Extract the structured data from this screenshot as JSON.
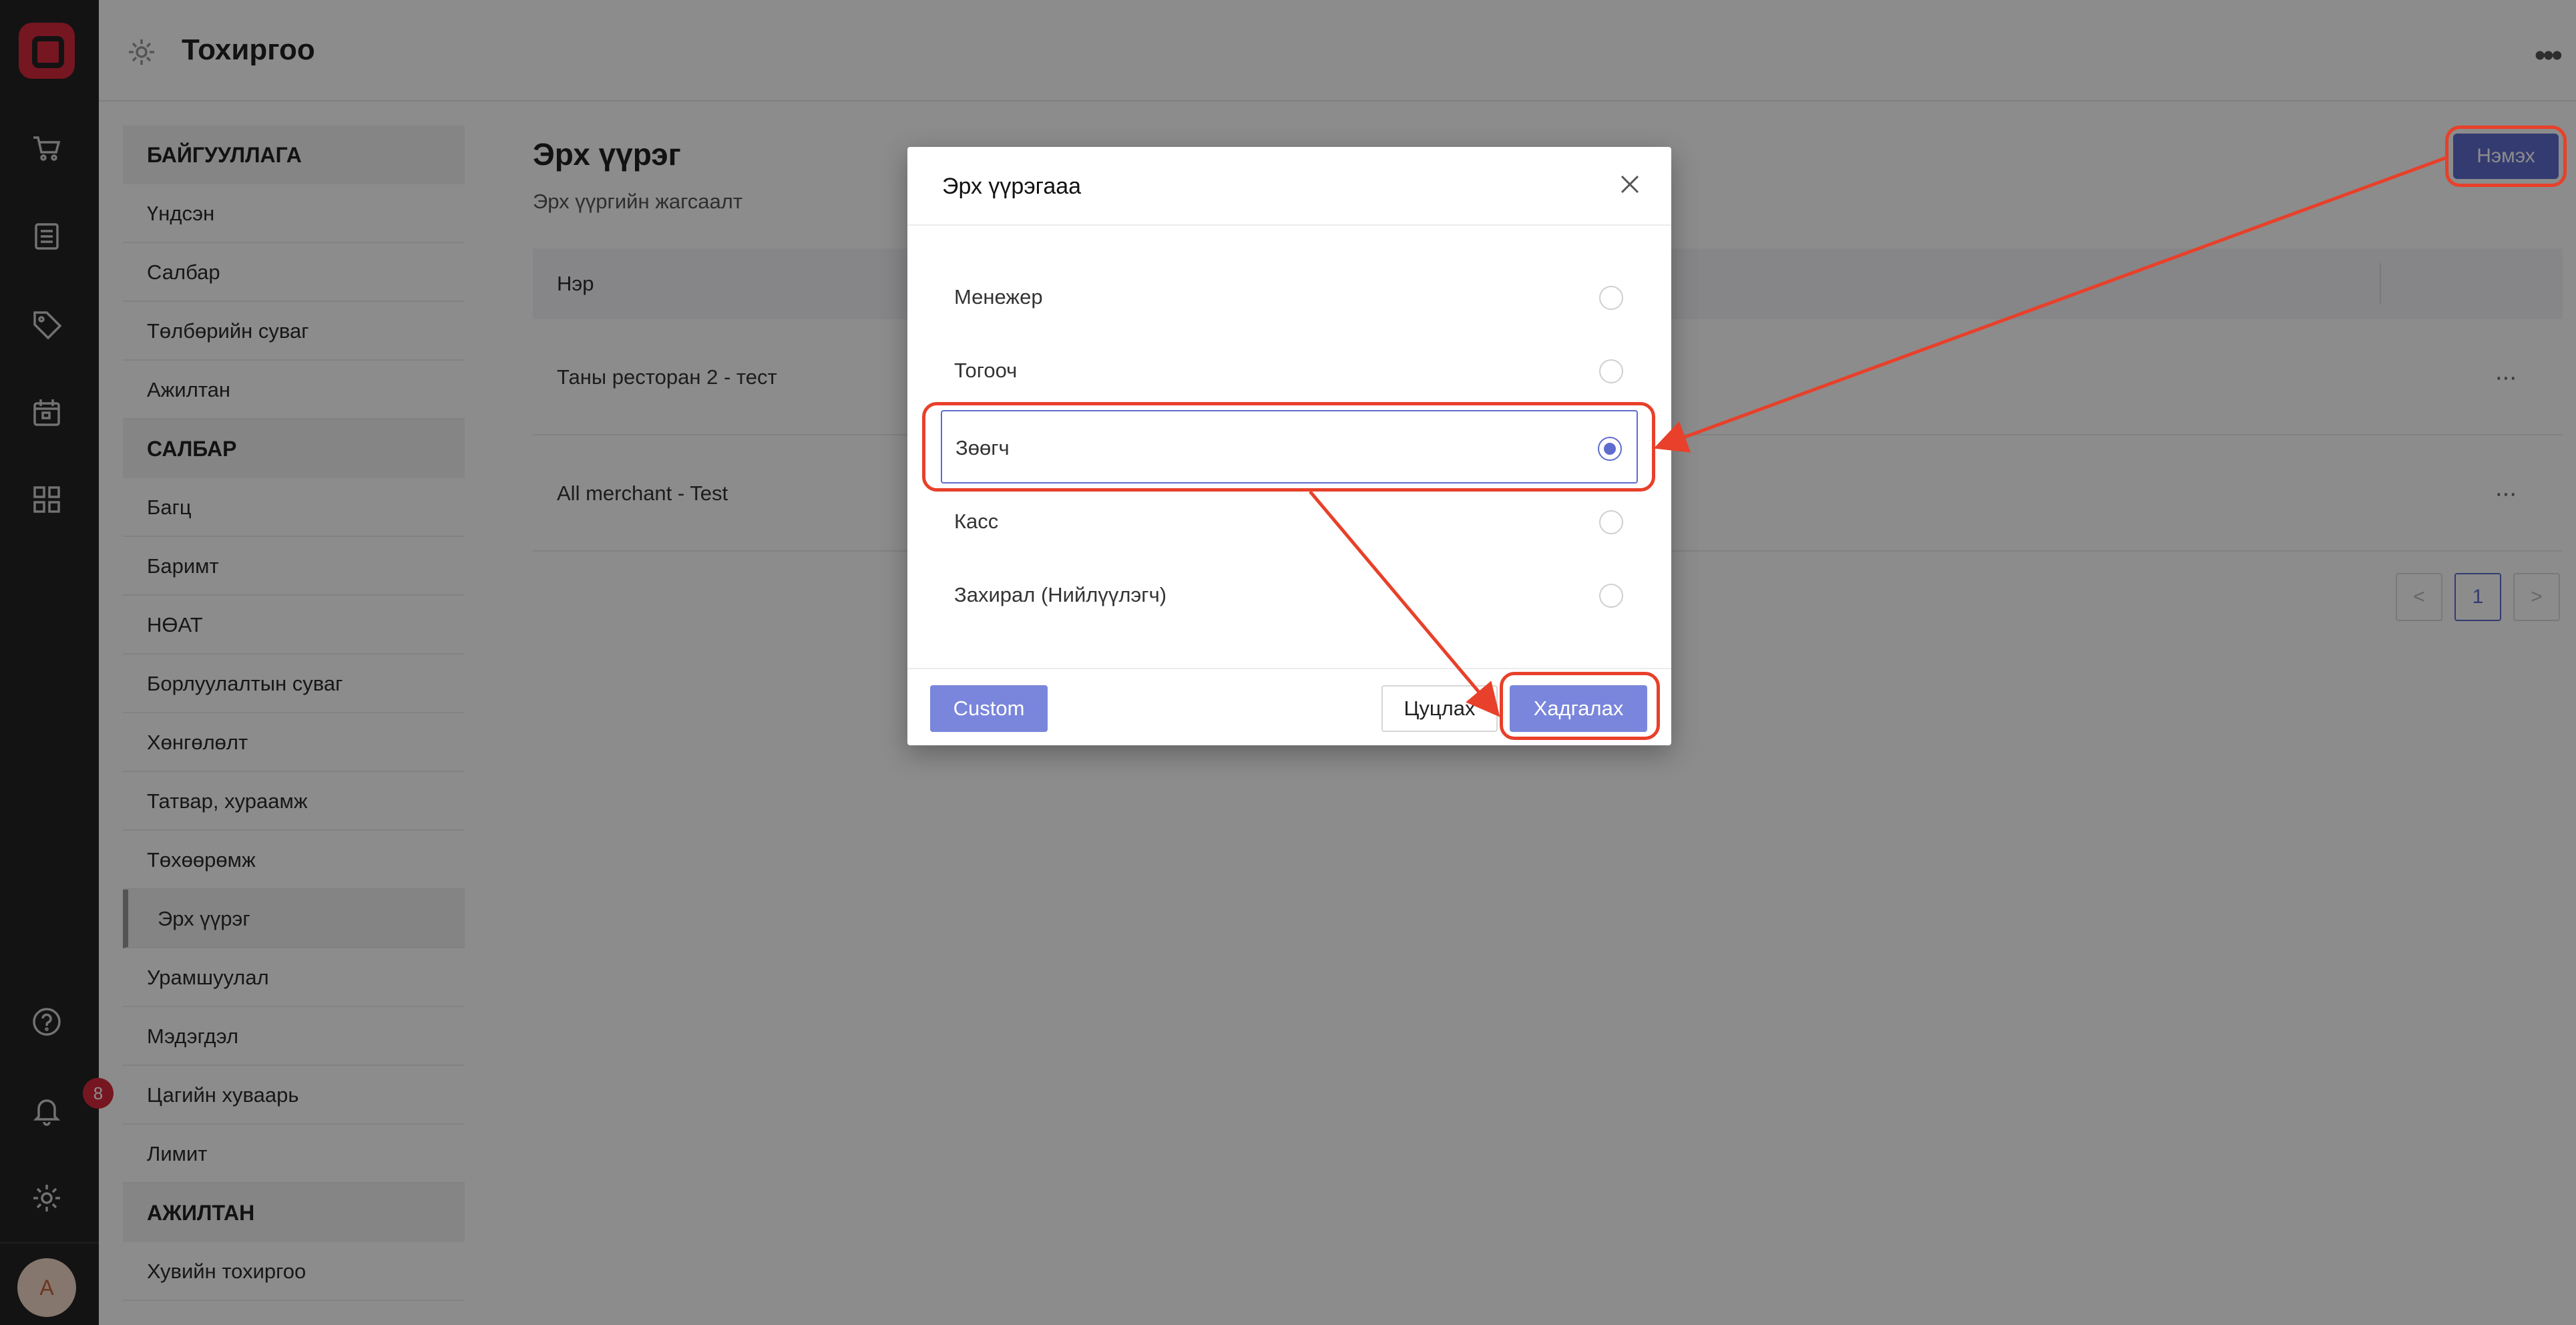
{
  "header": {
    "title": "Тохиргоо",
    "more_icon": "more-horizontal-icon"
  },
  "rail": {
    "icons": [
      "cart-icon",
      "list-icon",
      "tag-icon",
      "calendar-icon",
      "grid-icon",
      "help-icon",
      "bell-icon",
      "settings-icon"
    ],
    "notification_count": "8",
    "avatar_initial": "A"
  },
  "menu": {
    "sections": [
      {
        "title": "БАЙГУУЛЛАГА",
        "items": [
          "Үндсэн",
          "Салбар",
          "Төлбөрийн суваг",
          "Ажилтан"
        ]
      },
      {
        "title": "САЛБАР",
        "items": [
          "Багц",
          "Баримт",
          "НӨАТ",
          "Борлуулалтын суваг",
          "Хөнгөлөлт",
          "Татвар, хураамж",
          "Төхөөрөмж",
          "Эрх үүрэг",
          "Урамшуулал",
          "Мэдэгдэл",
          "Цагийн хуваарь",
          "Лимит"
        ]
      },
      {
        "title": "АЖИЛТАН",
        "items": [
          "Хувийн тохиргоо"
        ]
      }
    ],
    "active_item": "Эрх үүрэг"
  },
  "main": {
    "title": "Эрх үүрэг",
    "subtitle": "Эрх үүргийн жагсаалт",
    "add_label": "Нэмэх",
    "table": {
      "header": "Нэр",
      "rows": [
        "Таны ресторан 2 - тест",
        "All merchant - Test"
      ]
    },
    "pagination": {
      "prev": "<",
      "current": "1",
      "next": ">"
    }
  },
  "modal": {
    "title": "Эрх үүрэгааа",
    "options": [
      "Менежер",
      "Тогооч",
      "Зөөгч",
      "Касс",
      "Захирал (Нийлүүлэгч)"
    ],
    "selected_option": "Зөөгч",
    "custom_label": "Custom",
    "cancel_label": "Цуцлах",
    "save_label": "Хадгалах"
  },
  "colors": {
    "accent": "#5e6cce",
    "annotation": "#e8402a",
    "brand": "#d8283c"
  }
}
